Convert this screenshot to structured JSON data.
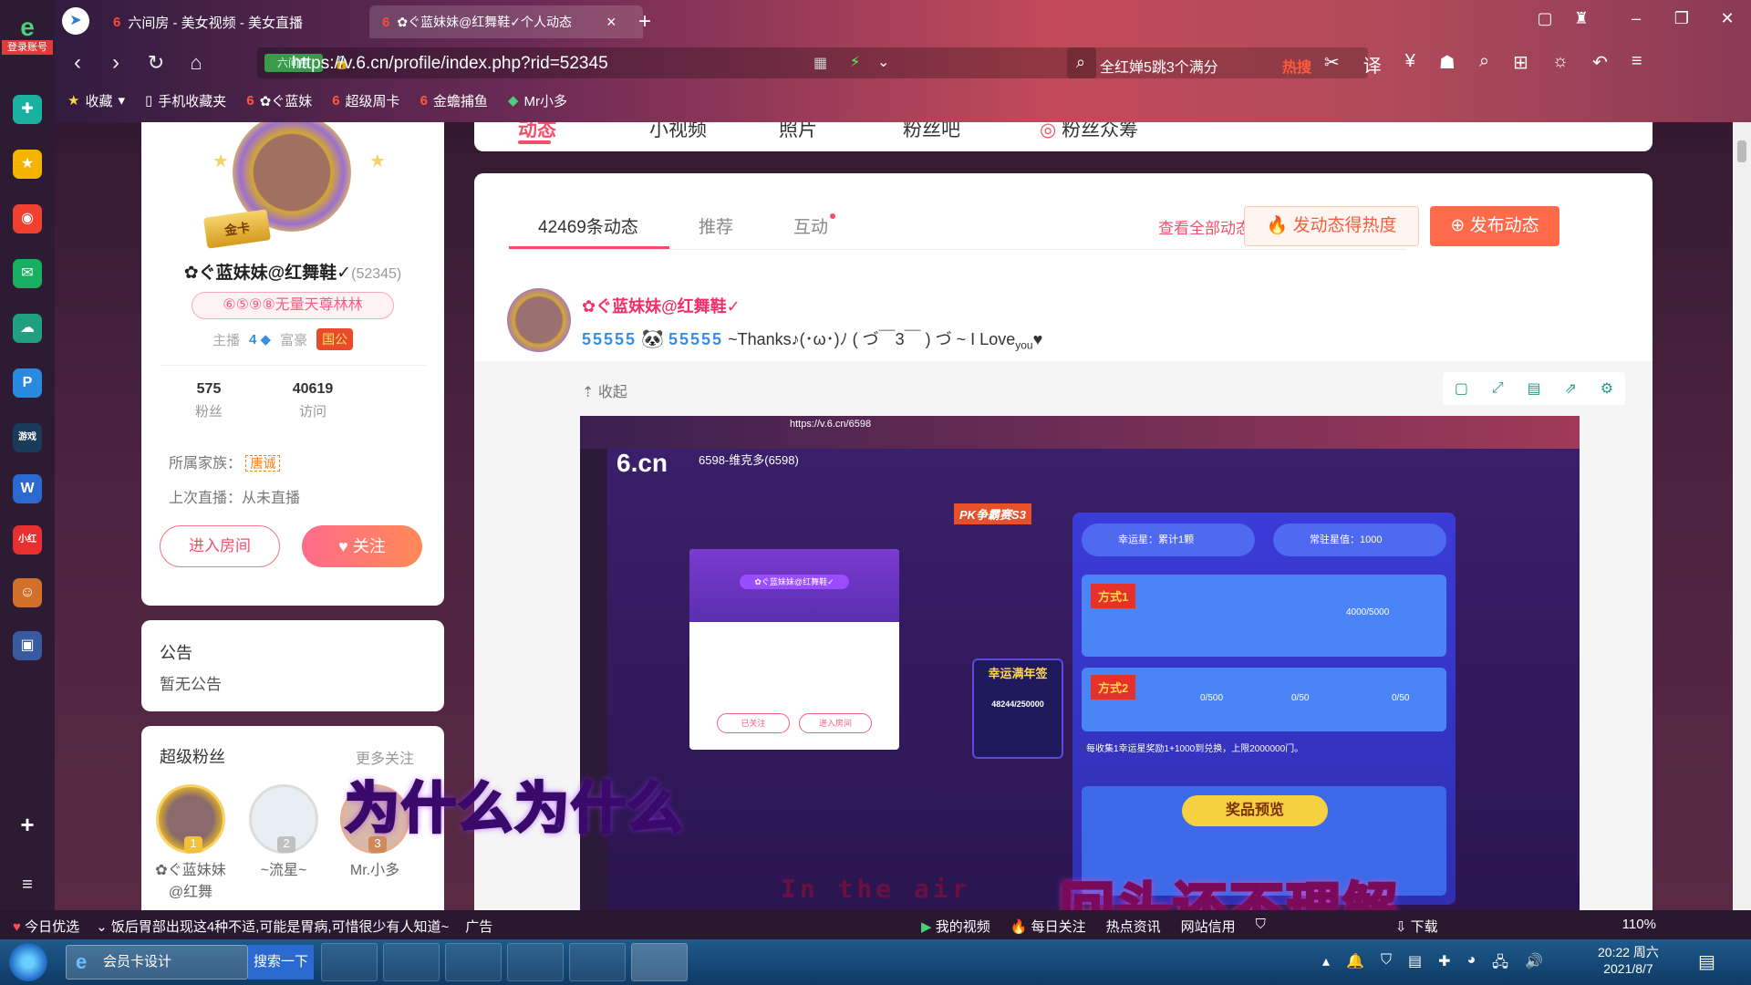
{
  "browser": {
    "tabs": [
      {
        "label": "六间房 - 美女视频 - 美女直播",
        "active": false
      },
      {
        "label": "✿ぐ蓝妹妹@红舞鞋✓个人动态",
        "active": true
      }
    ],
    "url": "https://v.6.cn/profile/index.php?rid=52345",
    "search_placeholder": "全红婵5跳3个满分",
    "search_hot": "热搜",
    "login_label": "登录账号",
    "bookmarks": [
      "收藏",
      "手机收藏夹",
      "✿ぐ蓝妹",
      "超级周卡",
      "金蟾捕鱼",
      "Mr小多"
    ],
    "zoom": "110%"
  },
  "profile": {
    "username": "✿ぐ蓝妹妹@红舞鞋✓",
    "rid": "(52345)",
    "fan_title": "⑥⑤⑨⑧无量天尊林林",
    "anchor_label": "主播",
    "anchor_level": "4",
    "rich_label": "富豪",
    "rich_badge": "国公",
    "badge": "金卡",
    "fans_count": "575",
    "fans_label": "粉丝",
    "visits_count": "40619",
    "visits_label": "访问",
    "family_label": "所属家族：",
    "family_tag": "唐诚",
    "last_live": "上次直播：从未直播",
    "enter_room": "进入房间",
    "follow": "关注"
  },
  "notice": {
    "title": "公告",
    "body": "暂无公告"
  },
  "super_fans": {
    "title": "超级粉丝",
    "more": "更多关注",
    "items": [
      {
        "rank": "1",
        "name": "✿ぐ蓝妹妹@红舞"
      },
      {
        "rank": "2",
        "name": "~流星~"
      },
      {
        "rank": "3",
        "name": "Mr.小多"
      }
    ]
  },
  "top_tabs": [
    "动态",
    "小视频",
    "照片",
    "粉丝吧",
    "粉丝众筹"
  ],
  "feed": {
    "tabs": [
      "42469条动态",
      "推荐",
      "互动"
    ],
    "view_all": "查看全部动态",
    "hot_button": "发动态得热度",
    "post_button": "发布动态",
    "post_author": "✿ぐ蓝妹妹@红舞鞋✓",
    "post_emoji": "55555",
    "post_emoji_2": "55555",
    "post_text": "~Thanks♪(･ω･)ﾉ ( づ￣3￣ ) づ ~ I Love",
    "post_text_sub": "you",
    "collapse": "收起"
  },
  "embed": {
    "url": "https://v.6.cn/6598",
    "host_name": "6598-维克多(6598)",
    "logo": "6.cn",
    "lucky_value": "幸运星：累计1颗",
    "fixed_value": "常驻星值：1000",
    "method1": "方式1",
    "method2": "方式2",
    "method1_amount": "4000/5000",
    "method2_values": [
      "0/500",
      "0/50",
      "0/50"
    ],
    "rule_text": "每收集1幸运星奖励1+1000到兑换，上限2000000门。",
    "prize_title": "奖品预览",
    "new_year_title": "幸运满年签",
    "new_year_value": "48244/250000",
    "popup_name": "✿ぐ蓝妹妹@红舞鞋✓",
    "popup_followed": "已关注",
    "popup_enter": "进入房间",
    "pk_label": "PK争霸赛S3"
  },
  "captions": {
    "line1": "为什么为什么",
    "line2": "回头还不理解",
    "line3": "In the air"
  },
  "statusbar": {
    "left": [
      "今日优选",
      "饭后胃部出现这4种不适,可能是胃病,可惜很少有人知道~",
      "广告"
    ],
    "right": [
      "我的视频",
      "每日关注",
      "热点资讯",
      "网站信用",
      "下载"
    ]
  },
  "taskbar": {
    "ie_label": "会员卡设计",
    "search_label": "搜索一下",
    "clock_time": "20:22 周六",
    "clock_date": "2021/8/7"
  }
}
